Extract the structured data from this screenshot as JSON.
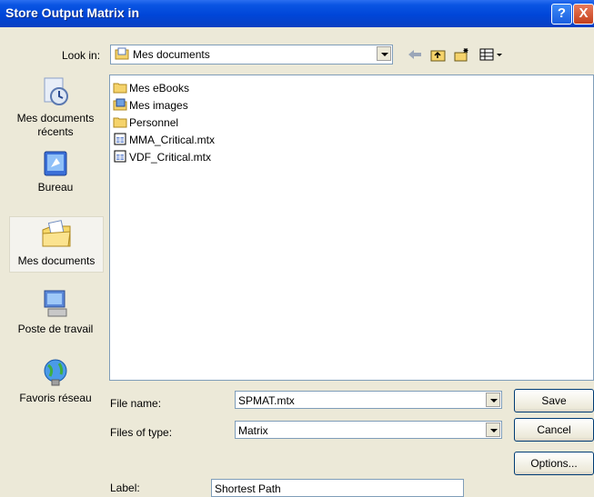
{
  "window": {
    "title": "Store Output Matrix in",
    "help_label": "?",
    "close_label": "X"
  },
  "lookin": {
    "label": "Look in:",
    "value": "Mes documents"
  },
  "toolbar": {
    "icons": [
      "back-arrow-icon",
      "up-one-level-icon",
      "new-folder-icon",
      "view-menu-icon"
    ]
  },
  "places": [
    {
      "label": "Mes documents récents",
      "icon": "recent-documents-icon"
    },
    {
      "label": "Bureau",
      "icon": "desktop-icon"
    },
    {
      "label": "Mes documents",
      "icon": "my-documents-icon"
    },
    {
      "label": "Poste de travail",
      "icon": "my-computer-icon"
    },
    {
      "label": "Favoris réseau",
      "icon": "network-places-icon"
    }
  ],
  "files": [
    {
      "name": "Mes eBooks",
      "type": "folder"
    },
    {
      "name": "Mes images",
      "type": "image-folder"
    },
    {
      "name": "Personnel",
      "type": "folder"
    },
    {
      "name": "MMA_Critical.mtx",
      "type": "matrix-file"
    },
    {
      "name": "VDF_Critical.mtx",
      "type": "matrix-file"
    }
  ],
  "form": {
    "filename_label": "File name:",
    "filename_value": "SPMAT.mtx",
    "filetype_label": "Files of type:",
    "filetype_value": "Matrix",
    "label_label": "Label:",
    "label_value": "Shortest Path"
  },
  "buttons": {
    "save": "Save",
    "cancel": "Cancel",
    "options": "Options..."
  }
}
